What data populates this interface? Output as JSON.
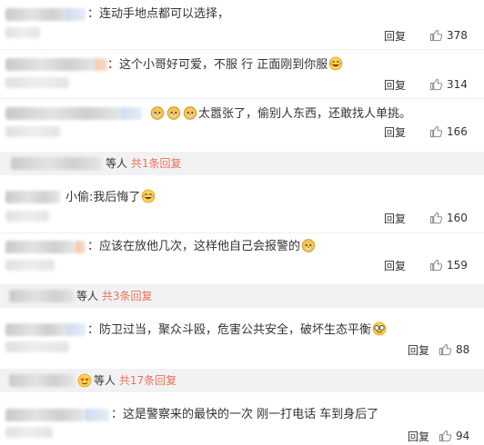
{
  "comments": [
    {
      "text": "：连动手地点都可以选择，",
      "reply": "回复",
      "likes": "378"
    },
    {
      "text": "：这个小哥好可爱，不服 行 正面刚到你服",
      "reply": "回复",
      "likes": "314"
    },
    {
      "text_after_emoji": "太嚣张了，偷别人东西，还敢找人单挑。",
      "reply": "回复",
      "likes": "166"
    },
    {
      "text": "小偷:我后悔了",
      "reply": "回复",
      "likes": "160"
    },
    {
      "text": "：应该在放他几次，这样他自己会报警的",
      "reply": "回复",
      "likes": "159"
    },
    {
      "text": "：防卫过当，聚众斗殴，危害公共安全，破坏生态平衡",
      "reply": "回复",
      "likes": "88"
    },
    {
      "text": "：这是警察来的最快的一次 刚一打电话 车到身后了",
      "reply": "回复",
      "likes": "94"
    }
  ],
  "subreplies": [
    {
      "people": "等人",
      "more": "共1条回复"
    },
    {
      "people": "等人",
      "more": "共3条回复"
    },
    {
      "people": "等人",
      "more": "共17条回复"
    }
  ]
}
